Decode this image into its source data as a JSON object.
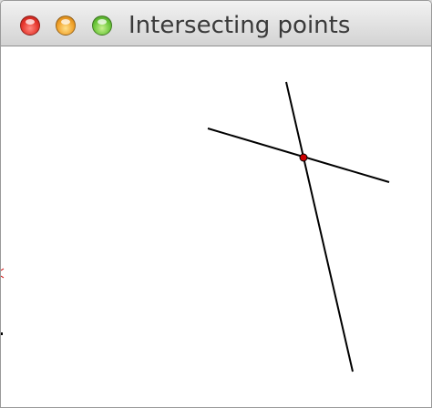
{
  "window": {
    "title": "Intersecting points"
  },
  "icons": {
    "close": "close-button-icon",
    "minimize": "minimize-button-icon",
    "zoom": "zoom-button-icon"
  },
  "colors": {
    "line": "#000000",
    "intersection_point": "#cc0000",
    "canvas_background": "#ffffff"
  }
}
